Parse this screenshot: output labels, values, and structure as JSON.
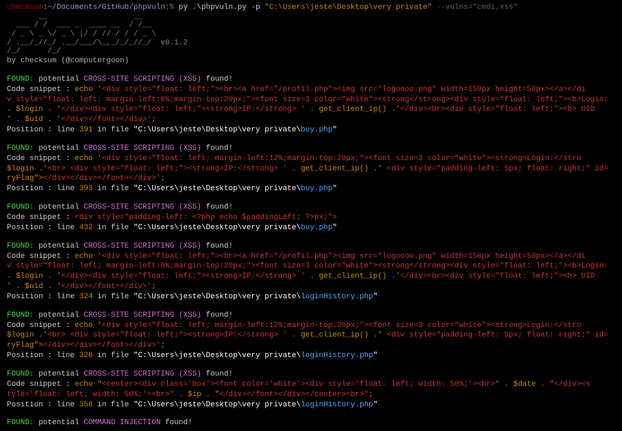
{
  "prompt": {
    "host": "checksum",
    "sep": ":",
    "path": "~/Documents/GitHub/phpvuln",
    "pct": ":%",
    "cmd": " py .\\phpvuln.py ",
    "flag1": "-p ",
    "quoted": "\"C:\\Users\\jeste\\Desktop\\very private\"",
    "flag2": " --vulns=\"cmdi,xss\""
  },
  "ascii": {
    "l1": "       __                   __      ",
    "l2": "  ___ / /  ___ _  ____ __  / /__    ",
    "l3": " / _ \\ _ \\/ _ \\ |/ / // / / / _ \\   ",
    "l4": "/ .__/_//_/ .__/___/\\_,_/_/_//_/  v0.1.2",
    "l5": "/_/      /_/                      "
  },
  "byline": "by checksum (@computergoon)",
  "finding1": {
    "found": "FOUND:",
    "pot": " potential ",
    "vuln": "CROSS-SITE SCRIPTING (XSS)",
    "tail": " found!",
    "snippet_label": "    Code snippet : ",
    "echo": "echo '",
    "s1": "<div style=\"float: left;\"><br><a href=\"/profil.php\"><img src=\"logoooo.png\" width=150px height=50px></a></di",
    "s2": "v style=\"float: left; margin-left:6%;margin-top:20px;\"><font size=3 color=\"white\"><strong</strong><div style=\"float: left;\"><b>Login:",
    "r1": ". $login . '",
    "s3": "</div><div style=\"float: left;\"><strong>IP:</strong> '",
    "r2": " . get_client_ip() .'",
    "s4": "</div><br><div style=\"float: left;\"><b> UID",
    "r3": "' . $uid . '",
    "s5": "</div></font></div>'",
    "end": ";",
    "pos_label": "    Position     : ",
    "line_pre": "line ",
    "line": "391",
    "in_file": " in file ",
    "path_pre": "\"C:\\Users\\jeste\\Desktop\\very private\\",
    "file": "buy.php",
    "close": "\""
  },
  "finding2": {
    "found": "FOUND:",
    "pot": " potential ",
    "vuln": "CROSS-SITE SCRIPTING (XSS)",
    "tail": " found!",
    "snippet_label": "    Code snippet : ",
    "echo": "echo '",
    "s1": "<div style=\"float: left; margin-left:12%;margin-top:20px;\"><font size=3 color=\"white\"><strong>Login:</stro",
    "r1": " $login .'",
    "s2": "<br> <div style=\"float: left;\"><strong>IP:</strong> '",
    "r2": " . get_client_ip() .'",
    "s3": " <div style=\"padding-left: 5px; float: right;\" id=",
    "r3": "ryFlag\">",
    "s4": "</div></div></font></div>'",
    "end": ";",
    "pos_label": "    Position     : ",
    "line_pre": "line ",
    "line": "393",
    "in_file": " in file ",
    "path_pre": "\"C:\\Users\\jeste\\Desktop\\very private\\",
    "file": "buy.php",
    "close": "\""
  },
  "finding3": {
    "found": "FOUND:",
    "pot": " potential ",
    "vuln": "CROSS-SITE SCRIPTING (XSS)",
    "tail": " found!",
    "snippet_label": "    Code snippet : ",
    "s1": "<div style=\"padding-left: <?php echo $paddingLeft; ?>px;\">",
    "pos_label": "    Position     : ",
    "line_pre": "line ",
    "line": "432",
    "in_file": " in file ",
    "path_pre": "\"C:\\Users\\jeste\\Desktop\\very private\\",
    "file": "buy.php",
    "close": "\""
  },
  "finding4": {
    "found": "FOUND:",
    "pot": " potential ",
    "vuln": "CROSS-SITE SCRIPTING (XSS)",
    "tail": " found!",
    "snippet_label": "    Code snippet : ",
    "echo": "echo '",
    "s1": "<div style=\"float: left;\"><br><a href=\"/profil.php\"><img src=\"logoooo.png\" width=150px height=50px></a></di",
    "s2": "v style=\"float: left; margin-left:6%;margin-top:20px;\"><font size=3 color=\"white\"><strong</strong><div style=\"float: left;\"><b>Login:",
    "r1": ". $login . '",
    "s3": "</div><div style=\"float: left;\"><strong>IP:</strong> '",
    "r2": " . get_client_ip() .'",
    "s4": "</div><br><div style=\"float: left;\"><b> UID",
    "r3": "' . $uid . '",
    "s5": "</div></font></div>'",
    "end": ";",
    "pos_label": "    Position     : ",
    "line_pre": "line ",
    "line": "324",
    "in_file": " in file ",
    "path_pre": "\"C:\\Users\\jeste\\Desktop\\very private\\",
    "file": "loginHistory.php",
    "close": "\""
  },
  "finding5": {
    "found": "FOUND:",
    "pot": " potential ",
    "vuln": "CROSS-SITE SCRIPTING (XSS)",
    "tail": " found!",
    "snippet_label": "    Code snippet : ",
    "echo": "echo '",
    "s1": "<div style=\"float: left; margin-left:12%;margin-top:20px;\"><font size=3 color=\"white\"><strong>Login:</stro",
    "r1": " $login .'",
    "s2": "<br> <div style=\"float: left;\"><strong>IP:</strong> '",
    "r2": " . get_client_ip() .'",
    "s3": " <div style=\"padding-left: 5px; float: right;\" id=",
    "r3": "ryFlag\">",
    "s4": "</div></div></font></div>'",
    "end": ";",
    "pos_label": "    Position     : ",
    "line_pre": "line ",
    "line": "326",
    "in_file": " in file ",
    "path_pre": "\"C:\\Users\\jeste\\Desktop\\very private\\",
    "file": "loginHistory.php",
    "close": "\""
  },
  "finding6": {
    "found": "FOUND:",
    "pot": " potential ",
    "vuln": "CROSS-SITE SCRIPTING (XSS)",
    "tail": " found!",
    "snippet_label": "    Code snippet : ",
    "echo": "echo \"",
    "s1": "<center><div class='box'><font color='white'><div style='float: left; width: 50%;'><br>\"",
    "r1": " . $date . \"",
    "s2": "</div><s",
    "r2": "tyle='float: left; width: 50%;'><br>\"",
    "r3": " . $ip . \"",
    "s3": "</div></font></div></center><br>\"",
    "end": ";",
    "pos_label": "    Position     : ",
    "line_pre": "line ",
    "line": "358",
    "in_file": " in file ",
    "path_pre": "\"C:\\Users\\jeste\\Desktop\\very private\\",
    "file": "loginHistory.php",
    "close": "\""
  },
  "finding7": {
    "found": "FOUND:",
    "pot": " potential ",
    "vuln": "COMMAND INJECTION",
    "tail": " found!"
  }
}
